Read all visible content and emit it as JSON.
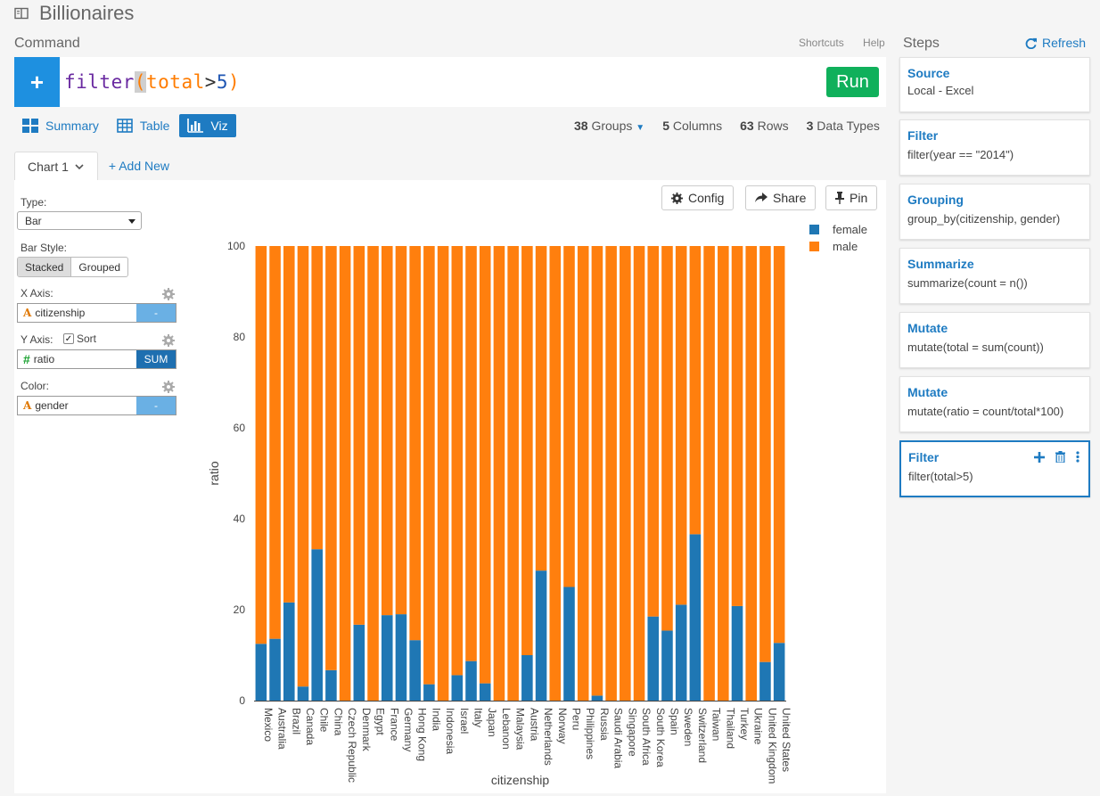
{
  "app": {
    "title": "Billionaires",
    "book_icon": "book-icon"
  },
  "command": {
    "label": "Command",
    "shortcuts_label": "Shortcuts",
    "help_label": "Help",
    "plus_label": "+",
    "code_fn": "filter",
    "code_open": "(",
    "code_ident": "total",
    "code_op": ">",
    "code_num": "5",
    "code_close": ")",
    "run_label": "Run"
  },
  "view_tabs": [
    {
      "label": "Summary",
      "icon": "grid-icon",
      "active": false
    },
    {
      "label": "Table",
      "icon": "table-icon",
      "active": false
    },
    {
      "label": "Viz",
      "icon": "bar-chart-icon",
      "active": true
    }
  ],
  "stats": {
    "groups_count": "38",
    "groups_label": "Groups",
    "columns_count": "5",
    "columns_label": "Columns",
    "rows_count": "63",
    "rows_label": "Rows",
    "types_count": "3",
    "types_label": "Data Types"
  },
  "chart_tabs": {
    "active_label": "Chart 1",
    "add_label": "+ Add New"
  },
  "options": {
    "type_label": "Type:",
    "type_value": "Bar",
    "bar_style_label": "Bar Style:",
    "bar_style_options": [
      "Stacked",
      "Grouped"
    ],
    "bar_style_selected": "Stacked",
    "x_label": "X Axis:",
    "x_field": "citizenship",
    "x_btn": "-",
    "y_label": "Y Axis:",
    "sort_label": "Sort",
    "sort_checked": true,
    "y_field": "ratio",
    "y_btn": "SUM",
    "color_label": "Color:",
    "color_field": "gender",
    "color_btn": "-"
  },
  "chart_actions": {
    "config_label": "Config",
    "share_label": "Share",
    "pin_label": "Pin"
  },
  "chart_data": {
    "type": "bar",
    "stacked": true,
    "xlabel": "citizenship",
    "ylabel": "ratio",
    "ylim": [
      0,
      100
    ],
    "yticks": [
      0,
      20,
      40,
      60,
      80,
      100
    ],
    "legend_position": "top-right",
    "categories": [
      "Mexico",
      "Australia",
      "Brazil",
      "Canada",
      "Chile",
      "China",
      "Czech Republic",
      "Denmark",
      "Egypt",
      "France",
      "Germany",
      "Hong Kong",
      "India",
      "Indonesia",
      "Israel",
      "Italy",
      "Japan",
      "Lebanon",
      "Malaysia",
      "Austria",
      "Netherlands",
      "Norway",
      "Peru",
      "Philippines",
      "Russia",
      "Saudi Arabia",
      "Singapore",
      "South Africa",
      "South Korea",
      "Spain",
      "Sweden",
      "Switzerland",
      "Taiwan",
      "Thailand",
      "Turkey",
      "Ukraine",
      "United Kingdom",
      "United States"
    ],
    "series": [
      {
        "name": "female",
        "color": "#1f77b4",
        "values": [
          12.5,
          13.6,
          21.6,
          3.1,
          33.3,
          6.7,
          0,
          16.7,
          0,
          18.8,
          19.0,
          13.3,
          3.6,
          0,
          5.6,
          8.7,
          3.8,
          0,
          0,
          10.0,
          28.6,
          0,
          25.0,
          0,
          1.1,
          0,
          0,
          0,
          18.5,
          15.4,
          21.1,
          36.6,
          0,
          0,
          20.8,
          0,
          8.5,
          12.7
        ]
      },
      {
        "name": "male",
        "color": "#ff7f0e",
        "values": [
          87.5,
          86.4,
          78.4,
          96.9,
          66.7,
          93.3,
          100,
          83.3,
          100,
          81.2,
          81.0,
          86.7,
          96.4,
          100,
          94.4,
          91.3,
          96.2,
          100,
          100,
          90.0,
          71.4,
          100,
          75.0,
          100,
          98.9,
          100,
          100,
          100,
          81.5,
          84.6,
          78.9,
          63.4,
          100,
          100,
          79.2,
          100,
          91.5,
          87.3
        ]
      }
    ]
  },
  "steps_panel": {
    "title": "Steps",
    "refresh_label": "Refresh"
  },
  "steps": [
    {
      "name": "Source",
      "desc": "Local - Excel"
    },
    {
      "name": "Filter",
      "desc": "filter(year == \"2014\")"
    },
    {
      "name": "Grouping",
      "desc": "group_by(citizenship, gender)"
    },
    {
      "name": "Summarize",
      "desc": "summarize(count = n())"
    },
    {
      "name": "Mutate",
      "desc": "mutate(total = sum(count))"
    },
    {
      "name": "Mutate",
      "desc": "mutate(ratio = count/total*100)"
    },
    {
      "name": "Filter",
      "desc": "filter(total>5)",
      "active": true
    }
  ]
}
